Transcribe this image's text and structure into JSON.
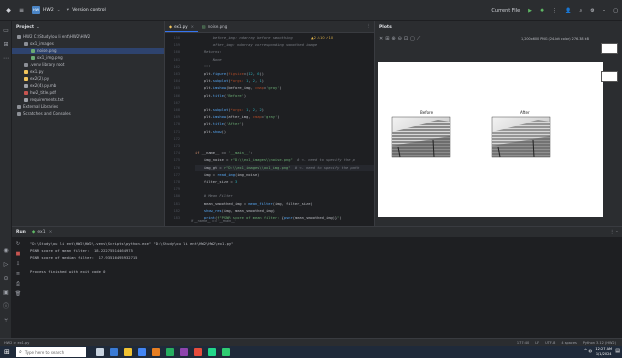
{
  "title_bar": {
    "project_badge": "HW",
    "project_name": "HW2",
    "vcs": "Version control",
    "run_config": "Current File",
    "accent": "#3574f0"
  },
  "project_panel": {
    "title": "Project",
    "items": [
      {
        "label": "HW2  C:\\Study\\ou li ent\\HW2\\HW2",
        "depth": 0,
        "icon": "folder-icon"
      },
      {
        "label": "ox1_images",
        "depth": 1,
        "icon": "folder-icon"
      },
      {
        "label": "noise.png",
        "depth": 2,
        "icon": "image-icon",
        "selected": true
      },
      {
        "label": "ox1_img.png",
        "depth": 2,
        "icon": "image-icon"
      },
      {
        "label": ".venv  library root",
        "depth": 1,
        "icon": "folder-icon"
      },
      {
        "label": "ex1.py",
        "depth": 1,
        "icon": "python-icon"
      },
      {
        "label": "ex2(2).py",
        "depth": 1,
        "icon": "python-icon"
      },
      {
        "label": "ex2(4).py.mb",
        "depth": 1,
        "icon": "file-icon"
      },
      {
        "label": "hw2_title.pdf",
        "depth": 1,
        "icon": "pdf-icon"
      },
      {
        "label": "requirements.txt",
        "depth": 1,
        "icon": "text-icon"
      },
      {
        "label": "External Libraries",
        "depth": 0,
        "icon": "library-icon"
      },
      {
        "label": "Scratches and Consoles",
        "depth": 0,
        "icon": "scratch-icon"
      }
    ]
  },
  "editor": {
    "tabs": [
      {
        "label": "ex1.py",
        "active": true
      },
      {
        "label": "noise.png",
        "active": false
      }
    ],
    "inspection": "▲2  ⚠10  ✓10",
    "breadcrumb": "if __name__ == '__main__'",
    "lines": [
      {
        "n": "158",
        "parts": [
          [
            "cm",
            "        before_img: ndarray before smoothing"
          ]
        ]
      },
      {
        "n": "159",
        "parts": [
          [
            "cm",
            "        after_img: ndarray corresponding smoothed image"
          ]
        ]
      },
      {
        "n": "160",
        "parts": [
          [
            "cm",
            "    Returns:"
          ]
        ]
      },
      {
        "n": "161",
        "parts": [
          [
            "cm",
            "        None"
          ]
        ]
      },
      {
        "n": "162",
        "parts": [
          [
            "cm",
            "    \"\"\""
          ]
        ]
      },
      {
        "n": "163",
        "parts": [
          [
            "",
            "    plt."
          ],
          [
            "fn",
            "figure"
          ],
          [
            "",
            "("
          ],
          [
            "pm",
            "figsize"
          ],
          [
            "",
            "=("
          ],
          [
            "nm",
            "12"
          ],
          [
            "",
            ", "
          ],
          [
            "nm",
            "6"
          ],
          [
            "",
            "))"
          ]
        ]
      },
      {
        "n": "164",
        "parts": [
          [
            "",
            "    plt."
          ],
          [
            "fn",
            "subplot"
          ],
          [
            "",
            "("
          ],
          [
            "pm",
            "*args: "
          ],
          [
            "nm",
            "1"
          ],
          [
            "",
            ", "
          ],
          [
            "nm",
            "2"
          ],
          [
            "",
            ", "
          ],
          [
            "nm",
            "1"
          ],
          [
            "",
            ")"
          ]
        ]
      },
      {
        "n": "165",
        "parts": [
          [
            "",
            "    plt."
          ],
          [
            "fn",
            "imshow"
          ],
          [
            "",
            "(before_img, "
          ],
          [
            "pm",
            "cmap"
          ],
          [
            "",
            "="
          ],
          [
            "st",
            "'gray'"
          ],
          [
            "",
            ")"
          ]
        ]
      },
      {
        "n": "166",
        "parts": [
          [
            "",
            "    plt."
          ],
          [
            "fn",
            "title"
          ],
          [
            "",
            "("
          ],
          [
            "st",
            "'Before'"
          ],
          [
            "",
            ")"
          ]
        ]
      },
      {
        "n": "167",
        "parts": [
          [
            "",
            ""
          ]
        ]
      },
      {
        "n": "168",
        "parts": [
          [
            "",
            "    plt."
          ],
          [
            "fn",
            "subplot"
          ],
          [
            "",
            "("
          ],
          [
            "pm",
            "*args: "
          ],
          [
            "nm",
            "1"
          ],
          [
            "",
            ", "
          ],
          [
            "nm",
            "2"
          ],
          [
            "",
            ", "
          ],
          [
            "nm",
            "2"
          ],
          [
            "",
            ")"
          ]
        ]
      },
      {
        "n": "169",
        "parts": [
          [
            "",
            "    plt."
          ],
          [
            "fn",
            "imshow"
          ],
          [
            "",
            "(after_img, "
          ],
          [
            "pm",
            "cmap"
          ],
          [
            "",
            "="
          ],
          [
            "st",
            "'gray'"
          ],
          [
            "",
            ")"
          ]
        ]
      },
      {
        "n": "170",
        "parts": [
          [
            "",
            "    plt."
          ],
          [
            "fn",
            "title"
          ],
          [
            "",
            "("
          ],
          [
            "st",
            "'After'"
          ],
          [
            "",
            ")"
          ]
        ]
      },
      {
        "n": "171",
        "parts": [
          [
            "",
            "    plt."
          ],
          [
            "fn",
            "show"
          ],
          [
            "",
            "()"
          ]
        ]
      },
      {
        "n": "172",
        "parts": [
          [
            "",
            ""
          ]
        ]
      },
      {
        "n": "173",
        "parts": [
          [
            "",
            ""
          ]
        ]
      },
      {
        "n": "174",
        "parts": [
          [
            "kw",
            "if "
          ],
          [
            "",
            "__name__ == "
          ],
          [
            "st",
            "'__main__'"
          ],
          [
            "",
            ":"
          ]
        ]
      },
      {
        "n": "175",
        "parts": [
          [
            "",
            "    img_noise = "
          ],
          [
            "st",
            "r\"D:\\\\ex1_images\\\\noise.png\""
          ],
          [
            "cm",
            "  # <- need to specify the p"
          ]
        ]
      },
      {
        "n": "176",
        "hl": true,
        "parts": [
          [
            "",
            "    img_gt = "
          ],
          [
            "st",
            "r\"D:\\\\ex1_images\\\\ox1_img.png\""
          ],
          [
            "cm",
            "  # <- need to specify the path"
          ]
        ]
      },
      {
        "n": "177",
        "parts": [
          [
            "",
            "    img = "
          ],
          [
            "fn",
            "read_img"
          ],
          [
            "",
            "(img_noise)"
          ]
        ]
      },
      {
        "n": "178",
        "parts": [
          [
            "",
            "    filter_size = "
          ],
          [
            "nm",
            "3"
          ]
        ]
      },
      {
        "n": "179",
        "parts": [
          [
            "",
            ""
          ]
        ]
      },
      {
        "n": "180",
        "parts": [
          [
            "cm",
            "    # Mean Filter"
          ]
        ]
      },
      {
        "n": "181",
        "parts": [
          [
            "",
            "    mean_smoothed_img = "
          ],
          [
            "fn",
            "mean_filter"
          ],
          [
            "",
            "(img, filter_size)"
          ]
        ]
      },
      {
        "n": "182",
        "parts": [
          [
            "",
            "    "
          ],
          [
            "fn",
            "show_res"
          ],
          [
            "",
            "(img, mean_smoothed_img)"
          ]
        ]
      },
      {
        "n": "183",
        "parts": [
          [
            "",
            "    "
          ],
          [
            "fn",
            "print"
          ],
          [
            "",
            "("
          ],
          [
            "st",
            "f\"PSNR score of mean filter: "
          ],
          [
            "",
            "{"
          ],
          [
            "fn",
            "psnr"
          ],
          [
            "",
            "(mean_smoothed_img)}"
          ],
          [
            "st",
            "\""
          ],
          [
            "",
            ")"
          ]
        ]
      }
    ]
  },
  "plots": {
    "title": "Plots",
    "info": "1,200x600 PNG (24-bit color) 276.38 kB",
    "left_title": "Before",
    "right_title": "After"
  },
  "run": {
    "tab_label": "Run",
    "config": "ex1",
    "lines": [
      "\"D:\\Study\\ou li ent\\HW2\\HW2\\.venv\\Scripts\\python.exe\" \"D:\\Study\\ou li ent\\HW2\\HW2\\ex1.py\"",
      "PSNR score of mean filter:  18.22275514464975",
      "PSNR score of median filter:  17.93516495932715",
      "",
      "Process finished with exit code 0"
    ]
  },
  "status_bar": {
    "path": "HW2 > ex1.py",
    "position": "177:40",
    "line_sep": "LF",
    "encoding": "UTF-8",
    "indent": "4 spaces",
    "interpreter": "Python 3.12 (HW2)"
  },
  "taskbar": {
    "search_placeholder": "Type here to search",
    "time": "12:27 AM",
    "date": "1/1/2024"
  }
}
